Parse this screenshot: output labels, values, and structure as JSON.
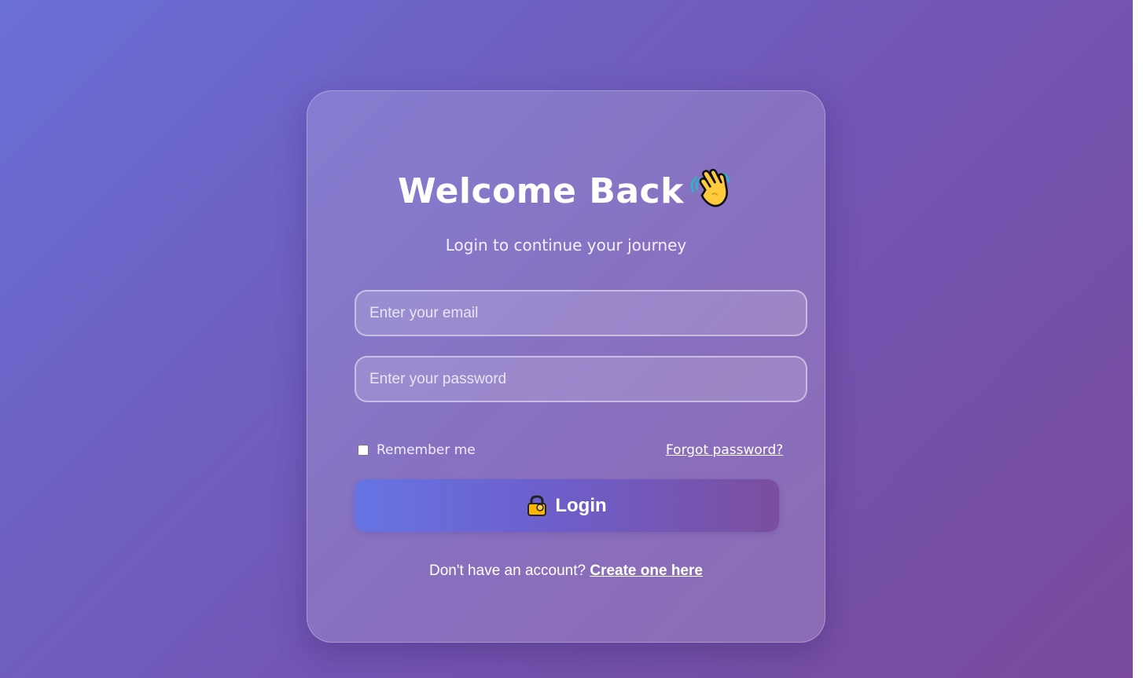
{
  "login": {
    "title": "Welcome Back",
    "subtitle": "Login to continue your journey",
    "email_placeholder": "Enter your email",
    "password_placeholder": "Enter your password",
    "remember_label": "Remember me",
    "forgot_link": "Forgot password?",
    "login_button": "Login",
    "signup_prompt": "Don't have an account?",
    "signup_link": "Create one here"
  },
  "icons": {
    "title_icon": "waving-hand-icon",
    "button_icon": "lock-icon"
  },
  "colors": {
    "background_start": "#6a6fd6",
    "background_end": "#7a4b9c",
    "button_start": "#6674e3",
    "button_end": "#7a4e9f",
    "text": "#ffffff"
  }
}
